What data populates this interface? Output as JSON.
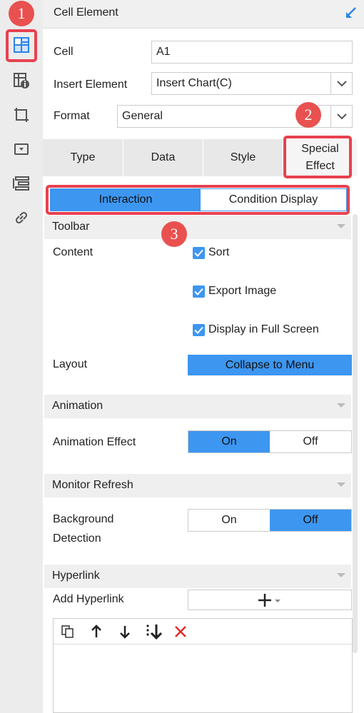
{
  "header": {
    "title": "Cell Element"
  },
  "fields": {
    "cell_label": "Cell",
    "cell_value": "A1",
    "insert_label": "Insert Element",
    "insert_value": "Insert Chart(C)",
    "format_label": "Format",
    "format_value": "General"
  },
  "tabs": [
    {
      "label": "Type"
    },
    {
      "label": "Data"
    },
    {
      "label": "Style"
    },
    {
      "label": "Special Effect",
      "active": true
    }
  ],
  "subtabs": {
    "interaction": "Interaction",
    "condition": "Condition Display"
  },
  "toolbar": {
    "section": "Toolbar",
    "content_label": "Content",
    "items": [
      "Sort",
      "Export Image",
      "Display in Full Screen"
    ],
    "layout_label": "Layout",
    "layout_value": "Collapse to Menu"
  },
  "animation": {
    "section": "Animation",
    "effect_label": "Animation Effect",
    "on": "On",
    "off": "Off",
    "selected": "On"
  },
  "monitor": {
    "section": "Monitor Refresh",
    "bg_label_line1": "Background",
    "bg_label_line2": "Detection",
    "on": "On",
    "off": "Off",
    "selected": "Off"
  },
  "hyperlink": {
    "section": "Hyperlink",
    "add_label": "Add Hyperlink"
  },
  "badges": [
    "1",
    "2",
    "3"
  ],
  "colors": {
    "accent": "#3d96f0",
    "highlight": "#e8414f",
    "badge": "#e8514f"
  }
}
